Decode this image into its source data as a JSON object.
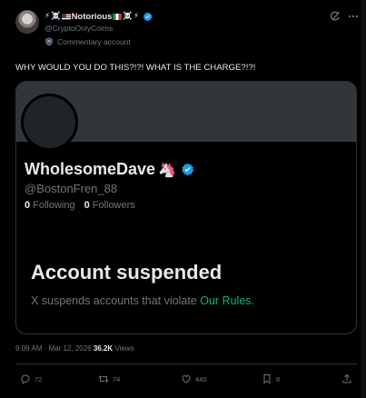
{
  "author": {
    "name": "Notorious",
    "handle": "@CryptoOnlyCoims",
    "label": "Commentary account",
    "prefix_emojis": [
      "⚡",
      "☠️"
    ],
    "suffix_emojis": [
      "☠️",
      "⚡"
    ]
  },
  "tweet": {
    "text": "WHY WOULD YOU DO THIS?!?! WHAT IS THE CHARGE?!?!"
  },
  "card": {
    "display_name": "WholesomeDave",
    "name_emoji": "🦄",
    "handle": "@BostonFren_88",
    "following_count": "0",
    "following_label": "Following",
    "followers_count": "0",
    "followers_label": "Followers",
    "suspended_title": "Account suspended",
    "suspended_text": "X suspends accounts that violate",
    "suspended_link": "Our Rules",
    "suspended_period": "."
  },
  "meta": {
    "time": "9:09 AM",
    "separator": " · ",
    "date": "Mar 12, 2026",
    "views_count": "36.2K",
    "views_label": "Views"
  },
  "actions": {
    "replies": "72",
    "reposts": "74",
    "likes": "440",
    "bookmarks": "8"
  },
  "colors": {
    "background": "#000000",
    "text": "#e7e9ea",
    "muted": "#71767b",
    "verified": "#1d9bf0",
    "link": "#00ba7c",
    "border": "#2f3336"
  },
  "icons": {
    "header": [
      "grok-icon",
      "more-icon"
    ],
    "actions": [
      "reply-icon",
      "repost-icon",
      "like-icon",
      "bookmark-icon",
      "share-icon"
    ]
  }
}
